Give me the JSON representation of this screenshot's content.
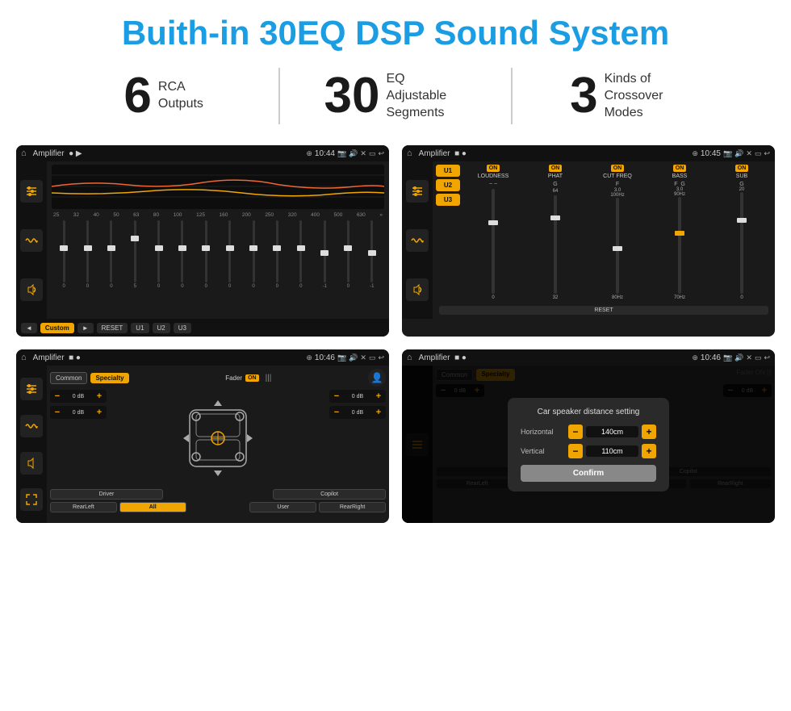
{
  "header": {
    "title": "Buith-in 30EQ DSP Sound System"
  },
  "stats": [
    {
      "number": "6",
      "label": "RCA\nOutputs"
    },
    {
      "number": "30",
      "label": "EQ Adjustable\nSegments"
    },
    {
      "number": "3",
      "label": "Kinds of\nCrossover Modes"
    }
  ],
  "screens": {
    "eq": {
      "title": "Amplifier",
      "time": "10:44",
      "freqs": [
        "25",
        "32",
        "40",
        "50",
        "63",
        "80",
        "100",
        "125",
        "160",
        "200",
        "250",
        "320",
        "400",
        "500",
        "630"
      ],
      "values": [
        "0",
        "0",
        "0",
        "5",
        "0",
        "0",
        "0",
        "0",
        "0",
        "0",
        "0",
        "-1",
        "0",
        "-1"
      ],
      "bottomBtns": [
        "◄",
        "Custom",
        "►",
        "RESET",
        "U1",
        "U2",
        "U3"
      ]
    },
    "crossover": {
      "title": "Amplifier",
      "time": "10:45",
      "uBtns": [
        "U1",
        "U2",
        "U3"
      ],
      "channels": [
        "LOUDNESS",
        "PHAT",
        "CUT FREQ",
        "BASS",
        "SUB"
      ],
      "resetLabel": "RESET"
    },
    "speaker": {
      "title": "Amplifier",
      "time": "10:46",
      "tabs": [
        "Common",
        "Specialty"
      ],
      "faderLabel": "Fader",
      "faderOn": "ON",
      "dbValues": [
        "0 dB",
        "0 dB",
        "0 dB",
        "0 dB"
      ],
      "bottomBtns": [
        "Driver",
        "",
        "",
        "",
        "",
        "",
        "Copilot",
        "RearLeft",
        "All",
        "",
        "User",
        "RearRight"
      ]
    },
    "dialog": {
      "title": "Amplifier",
      "time": "10:46",
      "dialogTitle": "Car speaker distance setting",
      "horizontal": {
        "label": "Horizontal",
        "value": "140cm"
      },
      "vertical": {
        "label": "Vertical",
        "value": "110cm"
      },
      "confirmLabel": "Confirm",
      "dbValues": [
        "0 dB",
        "0 dB"
      ],
      "bottomBtns": [
        "Driver",
        "",
        "Copilot",
        "RearLeft",
        "",
        "User",
        "RearRight"
      ]
    }
  },
  "icons": {
    "home": "⌂",
    "record": "●",
    "play": "▶",
    "location": "⊕",
    "camera": "📷",
    "volume": "🔊",
    "close": "✕",
    "window": "▭",
    "back": "↩",
    "wifi": "≋",
    "equalizer": "≡",
    "waveform": "∿",
    "speaker": "◈",
    "expand": "⤢",
    "person": "👤"
  },
  "colors": {
    "accent": "#f0a500",
    "bg": "#1a1a1a",
    "sidebar": "#111111",
    "text": "#cccccc",
    "headerBlue": "#1a9de2"
  }
}
